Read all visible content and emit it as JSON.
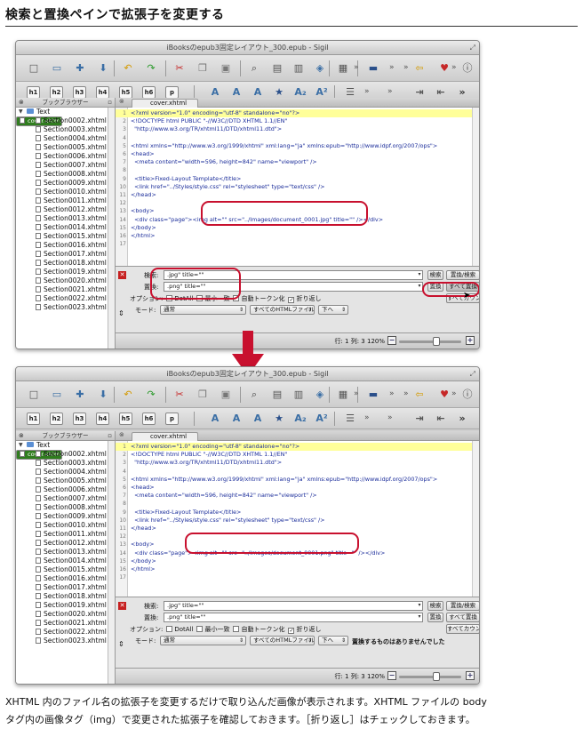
{
  "page_title": "検索と置換ペインで拡張子を変更する",
  "window_title": "iBooksのepub3固定レイアウト_300.epub - Sigil",
  "window_title_after": "iBooksのepub3固定レイアウト_300.epub - Sigil",
  "heading_buttons": [
    "h1",
    "h2",
    "h3",
    "h4",
    "h5",
    "h6",
    "p"
  ],
  "book_browser_title": "ブックブラウザー",
  "tree": {
    "folder": "Text",
    "files": [
      "cover.xhtml",
      "Section0002.xhtml",
      "Section0003.xhtml",
      "Section0004.xhtml",
      "Section0005.xhtml",
      "Section0006.xhtml",
      "Section0007.xhtml",
      "Section0008.xhtml",
      "Section0009.xhtml",
      "Section0010.xhtml",
      "Section0011.xhtml",
      "Section0012.xhtml",
      "Section0013.xhtml",
      "Section0014.xhtml",
      "Section0015.xhtml",
      "Section0016.xhtml",
      "Section0017.xhtml",
      "Section0018.xhtml",
      "Section0019.xhtml",
      "Section0020.xhtml",
      "Section0021.xhtml",
      "Section0022.xhtml",
      "Section0023.xhtml"
    ]
  },
  "tab_label": "cover.xhtml",
  "code_before": [
    {
      "n": "1",
      "t": "<?xml version=\"1.0\" encoding=\"utf-8\" standalone=\"no\"?>"
    },
    {
      "n": "2",
      "t": "<!DOCTYPE html PUBLIC \"-//W3C//DTD XHTML 1.1//EN\""
    },
    {
      "n": "3",
      "t": "  \"http://www.w3.org/TR/xhtml11/DTD/xhtml11.dtd\">"
    },
    {
      "n": "4",
      "t": ""
    },
    {
      "n": "5",
      "t": "<html xmlns=\"http://www.w3.org/1999/xhtml\" xml:lang=\"ja\" xmlns:epub=\"http://www.idpf.org/2007/ops\">"
    },
    {
      "n": "6",
      "t": "<head>"
    },
    {
      "n": "7",
      "t": "  <meta content=\"width=596, height=842\" name=\"viewport\" />"
    },
    {
      "n": "8",
      "t": ""
    },
    {
      "n": "9",
      "t": "  <title>Fixed-Layout Template</title>"
    },
    {
      "n": "10",
      "t": "  <link href=\"../Styles/style.css\" rel=\"stylesheet\" type=\"text/css\" />"
    },
    {
      "n": "11",
      "t": "</head>"
    },
    {
      "n": "12",
      "t": ""
    },
    {
      "n": "13",
      "t": "<body>"
    },
    {
      "n": "14",
      "t": "  <div class=\"page\"><img alt=\"\" src=\"../Images/document_0001.jpg\" title=\"\" /></div>"
    },
    {
      "n": "15",
      "t": "</body>"
    },
    {
      "n": "16",
      "t": "</html>"
    },
    {
      "n": "17",
      "t": ""
    }
  ],
  "code_after": [
    {
      "n": "1",
      "t": "<?xml version=\"1.0\" encoding=\"utf-8\" standalone=\"no\"?>"
    },
    {
      "n": "2",
      "t": "<!DOCTYPE html PUBLIC \"-//W3C//DTD XHTML 1.1//EN\""
    },
    {
      "n": "3",
      "t": "  \"http://www.w3.org/TR/xhtml11/DTD/xhtml11.dtd\">"
    },
    {
      "n": "4",
      "t": ""
    },
    {
      "n": "5",
      "t": "<html xmlns=\"http://www.w3.org/1999/xhtml\" xml:lang=\"ja\" xmlns:epub=\"http://www.idpf.org/2007/ops\">"
    },
    {
      "n": "6",
      "t": "<head>"
    },
    {
      "n": "7",
      "t": "  <meta content=\"width=596, height=842\" name=\"viewport\" />"
    },
    {
      "n": "8",
      "t": ""
    },
    {
      "n": "9",
      "t": "  <title>Fixed-Layout Template</title>"
    },
    {
      "n": "10",
      "t": "  <link href=\"../Styles/style.css\" rel=\"stylesheet\" type=\"text/css\" />"
    },
    {
      "n": "11",
      "t": "</head>"
    },
    {
      "n": "12",
      "t": ""
    },
    {
      "n": "13",
      "t": "<body>"
    },
    {
      "n": "14",
      "t": "  <div class=\"page\"><img alt=\"\" src=\"../Images/document_0001.png\" title=\"\" /></div>"
    },
    {
      "n": "15",
      "t": "</body>"
    },
    {
      "n": "16",
      "t": "</html>"
    },
    {
      "n": "17",
      "t": ""
    }
  ],
  "find": {
    "find_label": "検索:",
    "replace_label": "置換:",
    "find_value": ".jpg\" title=\"\"",
    "replace_value": ".png\" title=\"\"",
    "find_button": "検索",
    "replace_button": "置換",
    "replace_find_button": "置換/検索",
    "replace_all_button": "すべて置換",
    "count_all_button": "すべてカウント",
    "options_label": "オプション:",
    "opt_dotall": "DotAll",
    "opt_minimal": "最小一致",
    "opt_auto_token": "自動トークン化",
    "opt_wrap": "折り返し",
    "mode_label": "モード:",
    "mode_value": "通常",
    "scope_value": "すべてのHTMLファイル",
    "direction_value": "下へ",
    "result_message": "置換するものはありませんでした"
  },
  "status": {
    "position": "行: 1 列: 3",
    "zoom": "120%",
    "zoom_level": 0.6
  },
  "caption_lines": [
    "XHTML 内のファイル名の拡張子を変更するだけで取り込んだ画像が表示されます。XHTML ファイルの body",
    "タグ内の画像タグ（img）で変更された拡張子を確認しておきます。［折り返し］はチェックしておきます。"
  ],
  "accent_color": "#c8102e",
  "selection_color": "#2f7d1e"
}
